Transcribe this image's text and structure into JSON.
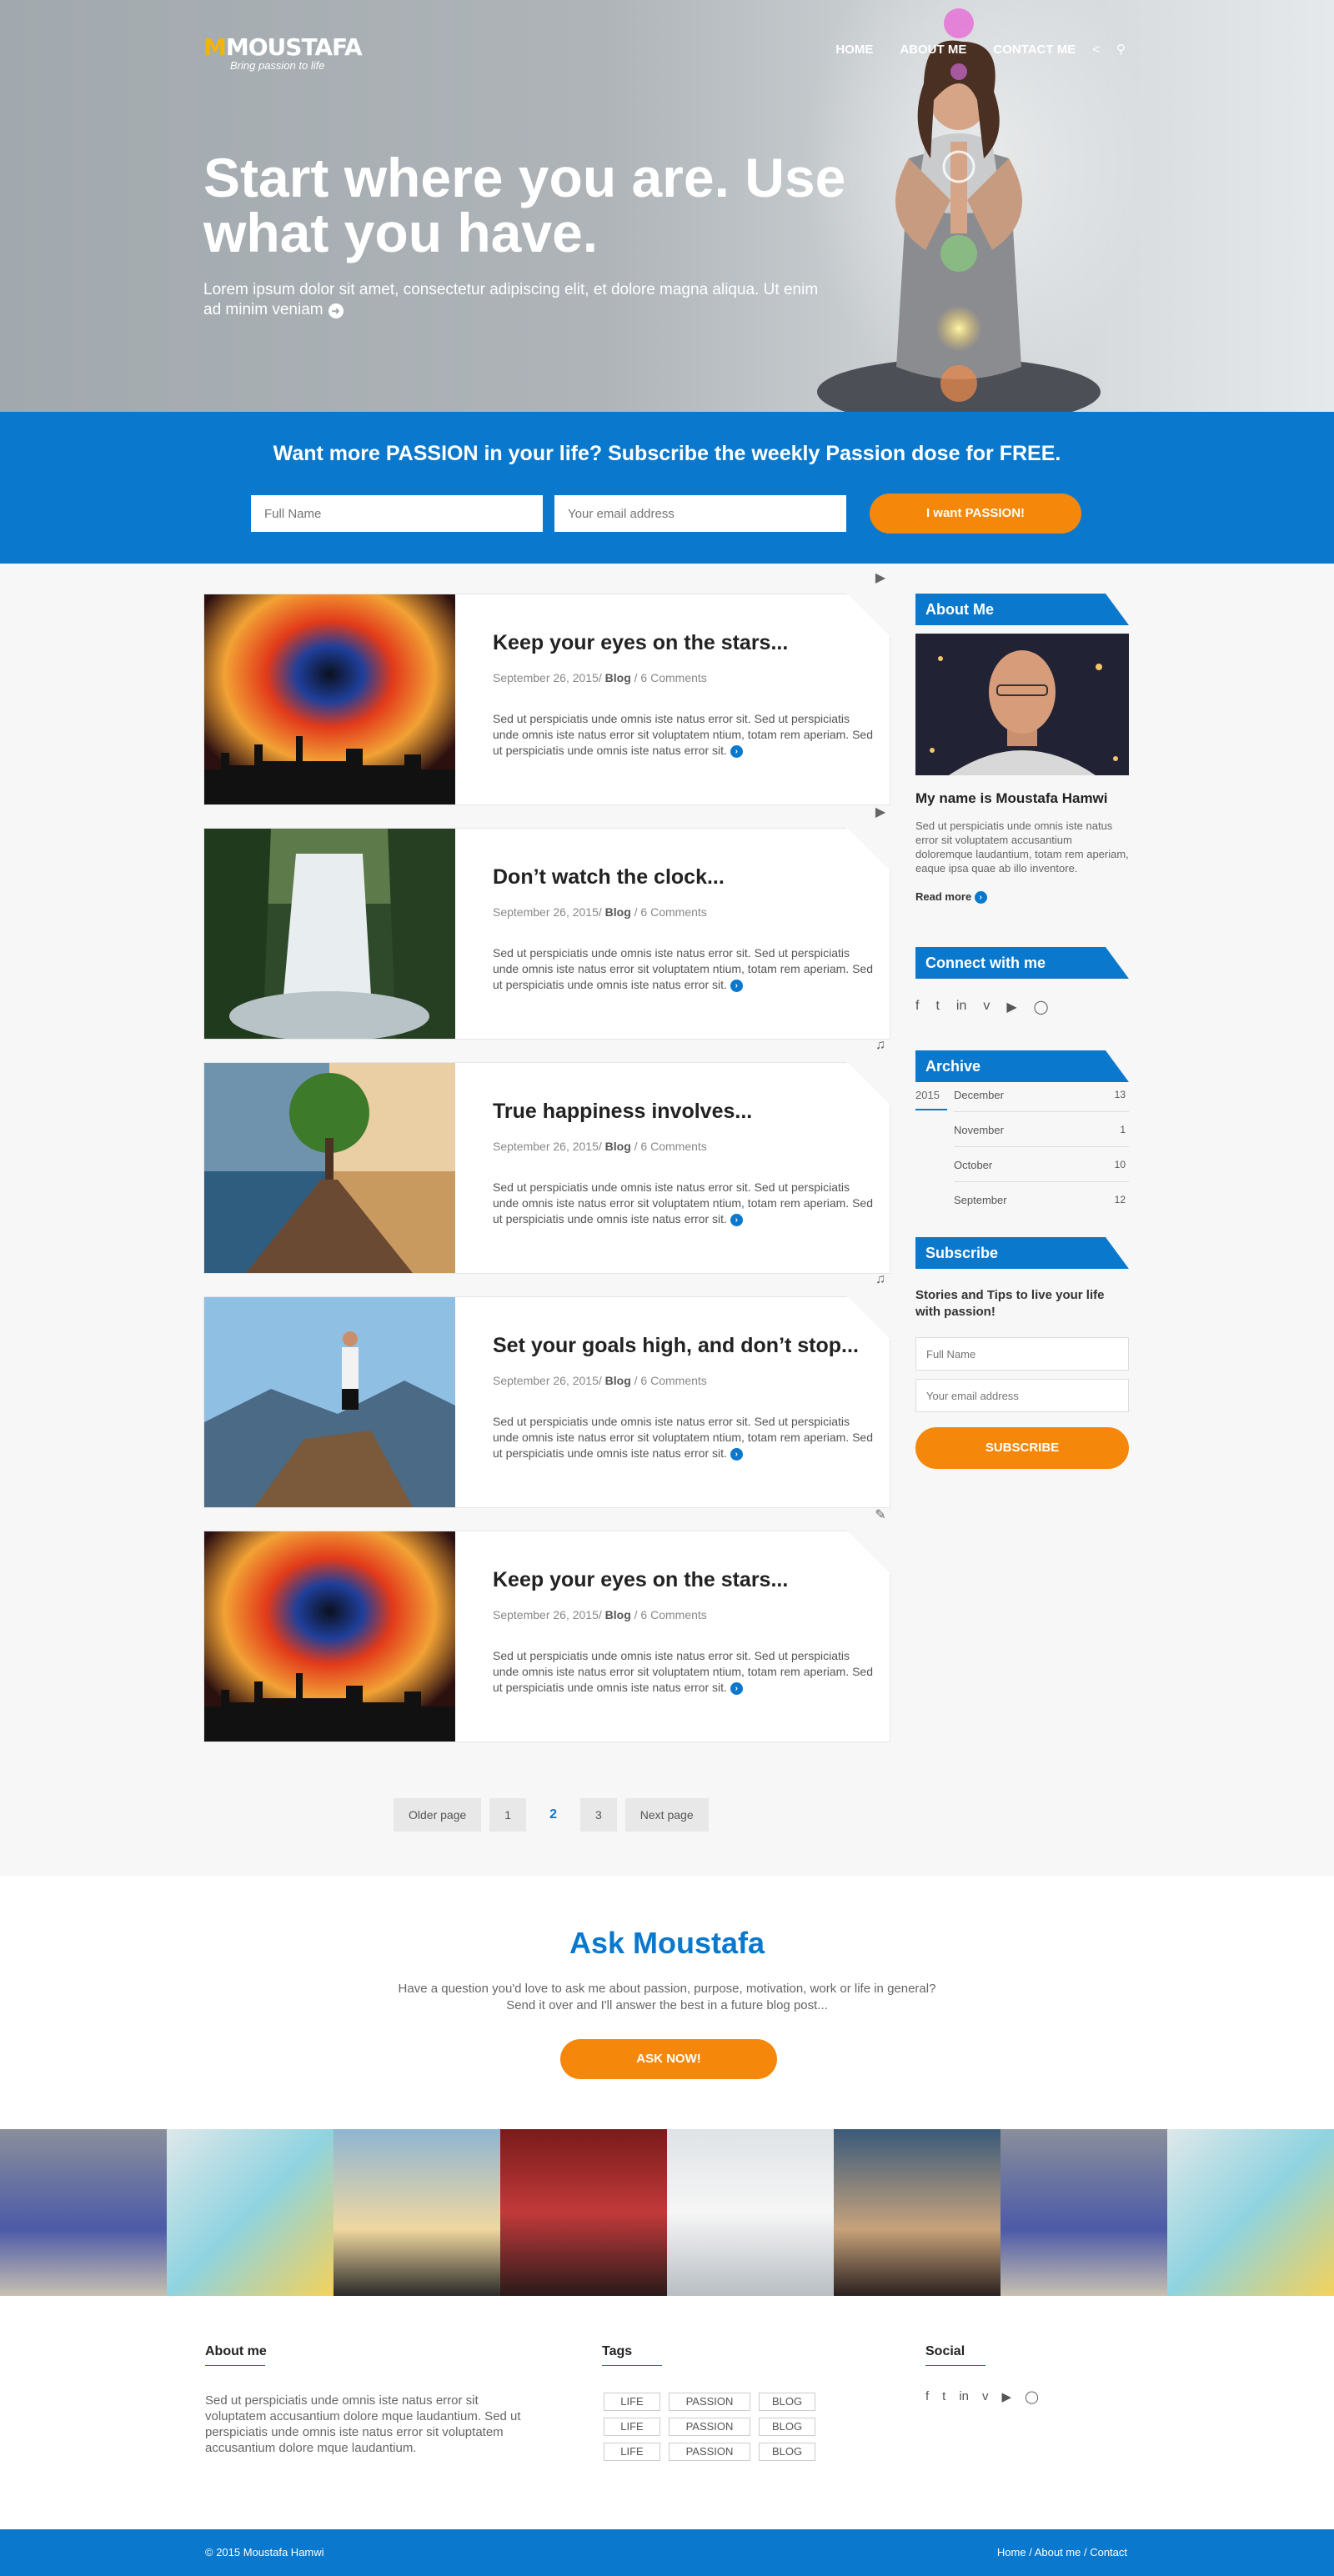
{
  "brand": {
    "logo_text": "MOUSTAFA",
    "logo_initial": "M",
    "tagline": "Bring passion to life"
  },
  "nav": {
    "items": [
      "HOME",
      "ABOUT ME",
      "CONTACT ME"
    ],
    "share_icon": "share-icon",
    "search_icon": "search-icon"
  },
  "hero": {
    "headline": "Start where you are. Use what you have.",
    "sub": "Lorem ipsum dolor sit amet, consectetur adipiscing elit, et dolore magna aliqua. Ut enim ad minim veniam"
  },
  "subscribe_band": {
    "title": "Want more PASSION in your life? Subscribe the weekly Passion dose for FREE.",
    "name_placeholder": "Full Name",
    "email_placeholder": "Your email address",
    "button": "I want PASSION!"
  },
  "posts": [
    {
      "title": "Keep your eyes on the stars...",
      "date": "September 26, 2015/ ",
      "category": "Blog",
      "comments": " / 6 Comments",
      "excerpt": "Sed ut perspiciatis unde omnis iste natus error sit. Sed ut perspiciatis unde omnis iste natus error sit voluptatem ntium, totam rem aperiam. Sed ut perspiciatis unde omnis iste natus error sit.",
      "type_icon": "video-icon"
    },
    {
      "title": "Don’t watch the clock...",
      "date": "September 26, 2015/ ",
      "category": "Blog",
      "comments": " / 6 Comments",
      "excerpt": "Sed ut perspiciatis unde omnis iste natus error sit. Sed ut perspiciatis unde omnis iste natus error sit voluptatem ntium, totam rem aperiam. Sed ut perspiciatis unde omnis iste natus error sit.",
      "type_icon": "video-icon"
    },
    {
      "title": "True happiness involves...",
      "date": "September 26, 2015/ ",
      "category": "Blog",
      "comments": " / 6 Comments",
      "excerpt": "Sed ut perspiciatis unde omnis iste natus error sit. Sed ut perspiciatis unde omnis iste natus error sit voluptatem ntium, totam rem aperiam. Sed ut perspiciatis unde omnis iste natus error sit.",
      "type_icon": "music-icon"
    },
    {
      "title": "Set your goals high, and don’t stop...",
      "date": "September 26, 2015/ ",
      "category": "Blog",
      "comments": " / 6 Comments",
      "excerpt": "Sed ut perspiciatis unde omnis iste natus error sit. Sed ut perspiciatis unde omnis iste natus error sit voluptatem ntium, totam rem aperiam. Sed ut perspiciatis unde omnis iste natus error sit.",
      "type_icon": "music-icon"
    },
    {
      "title": "Keep your eyes on the stars...",
      "date": "September 26, 2015/ ",
      "category": "Blog",
      "comments": " / 6 Comments",
      "excerpt": "Sed ut perspiciatis unde omnis iste natus error sit. Sed ut perspiciatis unde omnis iste natus error sit voluptatem ntium, totam rem aperiam. Sed ut perspiciatis unde omnis iste natus error sit.",
      "type_icon": "pencil-icon"
    }
  ],
  "pager": {
    "older": "Older page",
    "pages": [
      "1",
      "2",
      "3"
    ],
    "current": "2",
    "next": "Next page"
  },
  "sidebar": {
    "about_title": "About Me",
    "about_name": "My name is Moustafa Hamwi",
    "about_text": "Sed ut perspiciatis unde omnis iste natus error sit voluptatem accusantium doloremque laudantium, totam rem aperiam, eaque ipsa quae ab illo inventore.",
    "read_more": "Read more",
    "connect_title": "Connect with me",
    "social_icons": [
      "facebook-icon",
      "twitter-icon",
      "linkedin-icon",
      "vimeo-icon",
      "youtube-icon",
      "instagram-icon"
    ],
    "archive_title": "Archive",
    "archive_year": "2015",
    "archive": [
      {
        "month": "December",
        "count": "13"
      },
      {
        "month": "November",
        "count": "1"
      },
      {
        "month": "October",
        "count": "10"
      },
      {
        "month": "September",
        "count": "12"
      }
    ],
    "subscribe_title": "Subscribe",
    "subscribe_text": "Stories and Tips to live your life with passion!",
    "name_placeholder": "Full Name",
    "email_placeholder": "Your email address",
    "subscribe_button": "SUBSCRIBE"
  },
  "ask": {
    "title": "Ask Moustafa",
    "text1": "Have a question you'd love to ask me about passion, purpose, motivation, work or life in general?",
    "text2": "Send it over and I'll answer the best in a future blog post...",
    "button": "ASK NOW!"
  },
  "footer": {
    "about_title": "About me",
    "about_text": "Sed ut perspiciatis unde omnis iste natus error sit voluptatem accusantium dolore mque laudantium. Sed ut perspiciatis unde omnis iste natus error sit voluptatem accusantium dolore mque laudantium.",
    "tags_title": "Tags",
    "tags": [
      "LIFE",
      "PASSION",
      "BLOG",
      "LIFE",
      "PASSION",
      "BLOG",
      "LIFE",
      "PASSION",
      "BLOG"
    ],
    "social_title": "Social",
    "copyright": "© 2015 Moustafa Hamwi",
    "links": "Home / About me / Contact"
  },
  "colors": {
    "brand_blue": "#0a79cd",
    "accent_orange": "#f5870a"
  }
}
